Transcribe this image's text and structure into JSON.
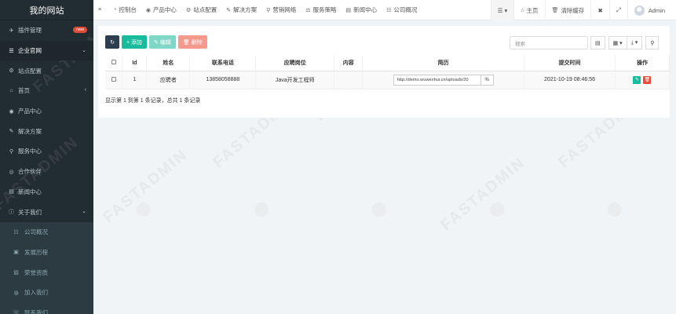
{
  "brand": "我的网站",
  "watermark": "FASTADMIN",
  "sidebar": {
    "items": [
      {
        "icon": "✈",
        "label": "插件管理",
        "badge": "new",
        "active": false,
        "sub": false
      },
      {
        "icon": "☰",
        "label": "企业官网",
        "arrow": "⌄",
        "active": true,
        "sub": false
      },
      {
        "icon": "⚙",
        "label": "站点配置",
        "active": false,
        "sub": false
      },
      {
        "icon": "⌂",
        "label": "首页",
        "arrow": "‹",
        "active": false,
        "sub": false
      },
      {
        "icon": "◉",
        "label": "产品中心",
        "active": false,
        "sub": false
      },
      {
        "icon": "✎",
        "label": "解决方案",
        "active": false,
        "sub": false
      },
      {
        "icon": "⚲",
        "label": "服务中心",
        "active": false,
        "sub": false
      },
      {
        "icon": "◎",
        "label": "合作伙伴",
        "active": false,
        "sub": false
      },
      {
        "icon": "▤",
        "label": "新闻中心",
        "active": false,
        "sub": false
      },
      {
        "icon": "ⓘ",
        "label": "关于我们",
        "arrow": "⌄",
        "active": false,
        "sub": false
      },
      {
        "icon": "☷",
        "label": "公司概况",
        "active": false,
        "sub": true
      },
      {
        "icon": "▣",
        "label": "发展历程",
        "active": false,
        "sub": true
      },
      {
        "icon": "▨",
        "label": "荣誉资质",
        "active": false,
        "sub": true
      },
      {
        "icon": "◍",
        "label": "加入我们",
        "active": false,
        "sub": true
      },
      {
        "icon": "☏",
        "label": "联系我们",
        "active": false,
        "sub": true
      }
    ]
  },
  "topnav": {
    "toggle_icon": "≡",
    "items": [
      {
        "icon": "◔",
        "label": "控制台"
      },
      {
        "icon": "◉",
        "label": "产品中心"
      },
      {
        "icon": "⚙",
        "label": "站点配置"
      },
      {
        "icon": "✎",
        "label": "解决方案"
      },
      {
        "icon": "⚲",
        "label": "营销网络"
      },
      {
        "icon": "⚖",
        "label": "服务策略"
      },
      {
        "icon": "▤",
        "label": "新闻中心"
      },
      {
        "icon": "☷",
        "label": "公司概况"
      }
    ],
    "right": {
      "menu_icon": "☰ ▾",
      "home": "主页",
      "home_icon": "⌂",
      "clear_cache": "清除缓存",
      "clear_icon": "🗑",
      "translate_icon": "✖",
      "fullscreen_icon": "⤢",
      "user": "Admin"
    }
  },
  "toolbar": {
    "refresh_icon": "↻",
    "add": "+ 添加",
    "edit": "✎ 编辑",
    "delete": "🗑 删除",
    "search_placeholder": "搜索",
    "view_icon": "▤",
    "columns_icon": "▦ ▾",
    "export_icon": "⤓ ▾",
    "adv_search_icon": "⚲"
  },
  "table": {
    "headers": [
      "Id",
      "姓名",
      "联系电话",
      "应聘岗位",
      "内容",
      "简历",
      "提交时间",
      "操作"
    ],
    "rows": [
      {
        "id": "1",
        "name": "应聘者",
        "phone": "13858058888",
        "position": "Java开发工程师",
        "content": "",
        "resume_url": "http://demo.wuwenhui.cn/uploads/20",
        "resume_btn_icon": "%",
        "submit_time": "2021-10-19 08:46:56",
        "edit_icon": "✎",
        "delete_icon": "🗑"
      }
    ]
  },
  "pagination": "显示第 1 到第 1 条记录，总共 1 条记录"
}
